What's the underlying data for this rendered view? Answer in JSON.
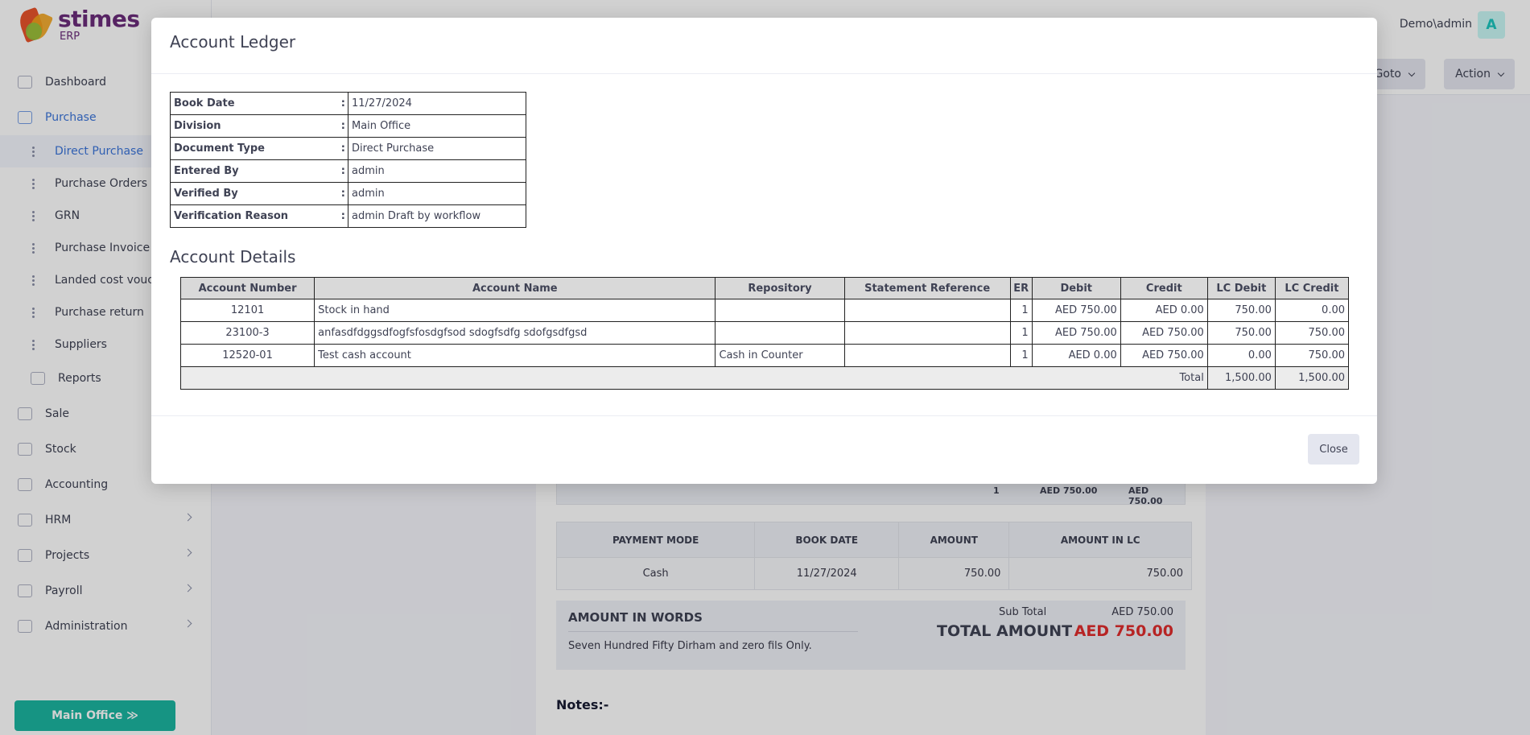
{
  "app": {
    "logo_name": "stimes",
    "logo_sub": "ERP"
  },
  "sidebar": {
    "items": [
      {
        "label": "Dashboard"
      },
      {
        "label": "Purchase"
      }
    ],
    "purchase_sub": [
      {
        "label": "Direct Purchase"
      },
      {
        "label": "Purchase Orders"
      },
      {
        "label": "GRN"
      },
      {
        "label": "Purchase Invoice"
      },
      {
        "label": "Landed cost voucher"
      },
      {
        "label": "Purchase return"
      },
      {
        "label": "Suppliers"
      }
    ],
    "reports_label": "Reports",
    "lower_items": [
      {
        "label": "Sale"
      },
      {
        "label": "Stock"
      },
      {
        "label": "Accounting"
      },
      {
        "label": "HRM"
      },
      {
        "label": "Projects"
      },
      {
        "label": "Payroll"
      },
      {
        "label": "Administration"
      }
    ],
    "office_button": "Main Office ≫"
  },
  "topbar": {
    "user": "Demo\\admin",
    "avatar": "A",
    "goto_label": "Goto",
    "action_label": "Action"
  },
  "document": {
    "total_row": {
      "qty": "1",
      "amount1": "AED 750.00",
      "amount2": "AED 750.00"
    },
    "payment_headers": [
      "PAYMENT MODE",
      "BOOK DATE",
      "AMOUNT",
      "AMOUNT IN LC"
    ],
    "payment_row": [
      "Cash",
      "11/27/2024",
      "750.00",
      "750.00"
    ],
    "amount_in_words_label": "AMOUNT IN WORDS",
    "amount_in_words": "Seven Hundred Fifty Dirham and zero fils Only.",
    "sub_total_label": "Sub Total",
    "sub_total_value": "AED 750.00",
    "total_amount_label": "TOTAL AMOUNT",
    "total_amount_value": "AED  750.00",
    "notes_label": "Notes:-"
  },
  "modal": {
    "title": "Account Ledger",
    "info": [
      {
        "label": "Book Date",
        "value": "11/27/2024"
      },
      {
        "label": "Division",
        "value": "Main Office"
      },
      {
        "label": "Document Type",
        "value": "Direct Purchase"
      },
      {
        "label": "Entered By",
        "value": "admin"
      },
      {
        "label": "Verified By",
        "value": "admin"
      },
      {
        "label": "Verification Reason",
        "value": "admin Draft by workflow"
      }
    ],
    "details_title": "Account Details",
    "columns": [
      "Account Number",
      "Account Name",
      "Repository",
      "Statement Reference",
      "ER",
      "Debit",
      "Credit",
      "LC Debit",
      "LC Credit"
    ],
    "rows": [
      [
        "12101",
        "Stock in hand",
        "",
        "",
        "1",
        "AED 750.00",
        "AED 0.00",
        "750.00",
        "0.00"
      ],
      [
        "23100-3",
        "anfasdfdggsdfogfsfosdgfsod sdogfsdfg sdofgsdfgsd",
        "",
        "",
        "1",
        "AED 750.00",
        "AED 750.00",
        "750.00",
        "750.00"
      ],
      [
        "12520-01",
        "Test cash account",
        "Cash in Counter",
        "",
        "1",
        "AED 0.00",
        "AED 750.00",
        "0.00",
        "750.00"
      ]
    ],
    "total_label": "Total",
    "total_lc_debit": "1,500.00",
    "total_lc_credit": "1,500.00",
    "close_label": "Close"
  }
}
